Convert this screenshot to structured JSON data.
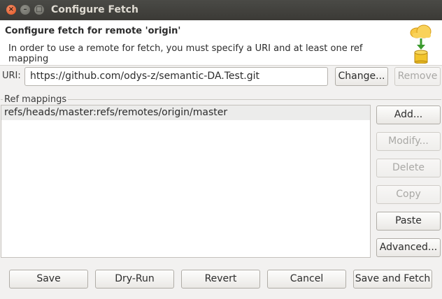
{
  "window": {
    "title": "Configure Fetch",
    "close_glyph": "×",
    "min_glyph": "–",
    "max_glyph": "□"
  },
  "header": {
    "title": "Configure fetch for remote 'origin'",
    "message": "In order to use a remote for fetch, you must specify a URI and at least one ref mapping",
    "icon": "cloud-fetch-database-icon"
  },
  "uri": {
    "label": "URI:",
    "value": "https://github.com/odys-z/semantic-DA.Test.git",
    "change_label": "Change...",
    "remove_label": "Remove"
  },
  "ref_mappings": {
    "group_label": "Ref mappings",
    "items": [
      "refs/heads/master:refs/remotes/origin/master"
    ],
    "buttons": {
      "add": "Add...",
      "modify": "Modify...",
      "delete": "Delete",
      "copy": "Copy",
      "paste": "Paste",
      "advanced": "Advanced..."
    }
  },
  "footer": {
    "save": "Save",
    "dry_run": "Dry-Run",
    "revert": "Revert",
    "cancel": "Cancel",
    "save_and_fetch": "Save and Fetch"
  }
}
